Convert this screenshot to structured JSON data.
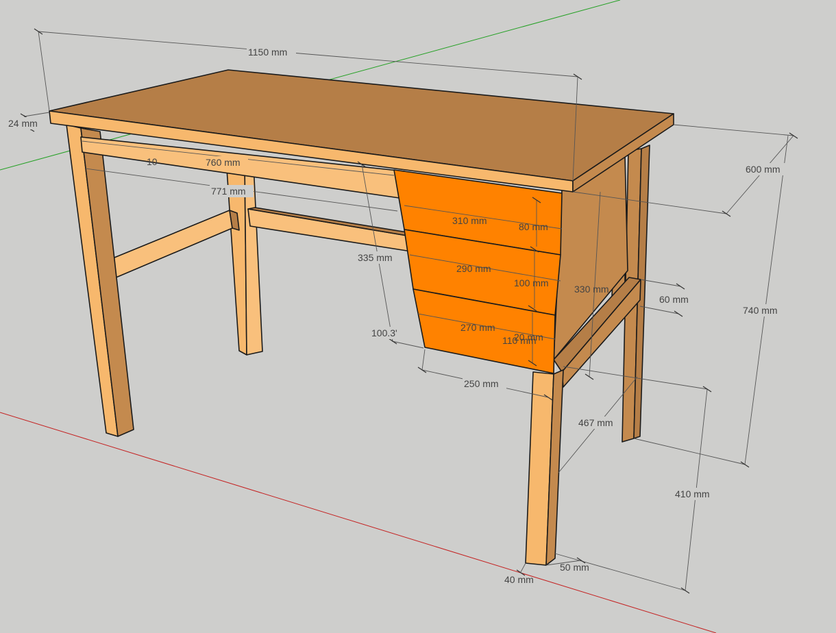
{
  "palette": {
    "background": "#cececc",
    "top_face": "#b57e47",
    "front_face": "#f7b86d",
    "side_face": "#c48a4e",
    "light_face": "#f9c07c",
    "drawer_front": "#ff8200",
    "axis_red": "#c42020",
    "axis_green": "#22a022"
  },
  "dimensions": {
    "width_1150": "1150 mm",
    "thickness_24": "24 mm",
    "apron_760": "760 mm",
    "rail_771": "771 mm",
    "depth_600": "600 mm",
    "drawer_310": "310 mm",
    "drawer_80": "80 mm",
    "drawer_290": "290 mm",
    "drawer_100": "100 mm",
    "drawer_270": "270 mm",
    "drawer_110": "110 mm",
    "drawer_20": "20 mm",
    "drawer_height_335": "335 mm",
    "angle_100_3": "100.3'",
    "drawer_bottom_250": "250 mm",
    "side_height_330": "330 mm",
    "rail_60": "60 mm",
    "height_740": "740 mm",
    "span_467": "467 mm",
    "rail_height_410": "410 mm",
    "leg_50": "50 mm",
    "leg_40": "40 mm",
    "hidden_fragment": "10"
  }
}
